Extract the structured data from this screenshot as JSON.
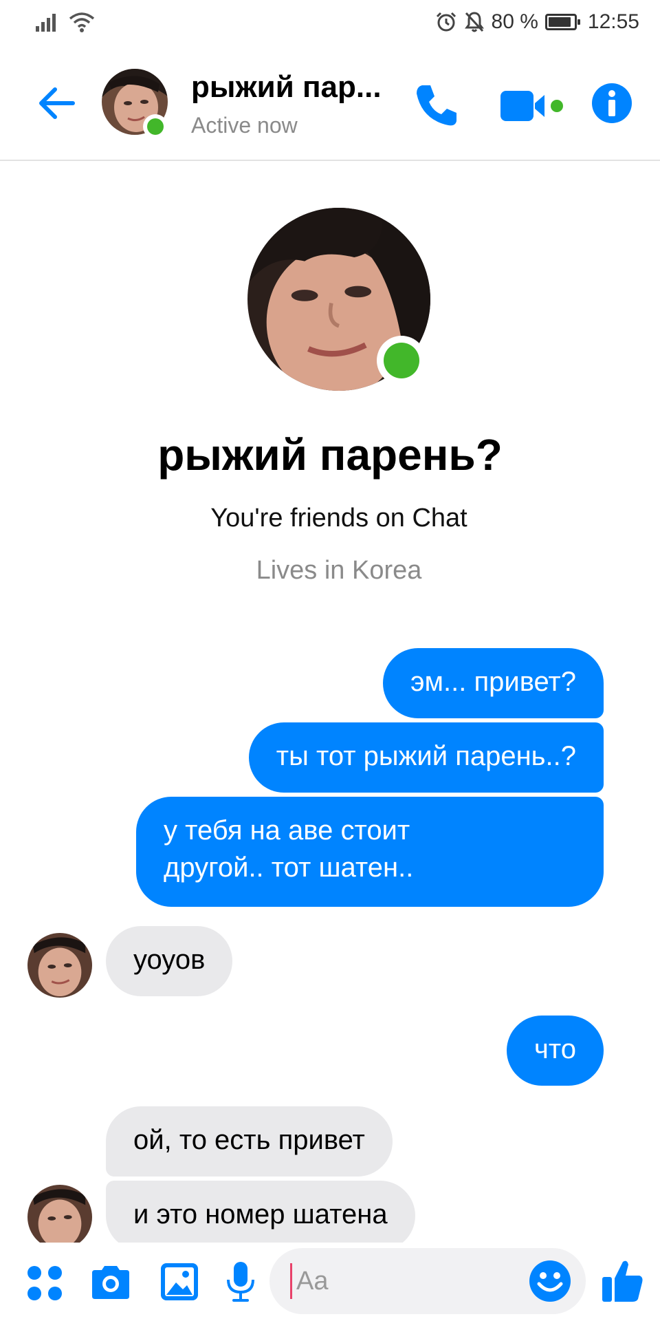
{
  "status_bar": {
    "battery": "80 %",
    "battery_level_percent": 80,
    "time": "12:55",
    "icons": [
      "signal-icon",
      "wifi-icon",
      "alarm-icon",
      "mute-icon",
      "battery-icon"
    ]
  },
  "header": {
    "contact_name": "рыжий пар...",
    "status": "Active now",
    "accent": "#0084ff",
    "online_color": "#42b72a"
  },
  "profile": {
    "name": "рыжий парень?",
    "friends_line": "You're friends on Chat",
    "lives_line": "Lives in Korea"
  },
  "messages": [
    {
      "direction": "outgoing",
      "lines": [
        "эм... привет?"
      ]
    },
    {
      "direction": "outgoing",
      "lines": [
        "ты тот рыжий парень..?"
      ]
    },
    {
      "direction": "outgoing",
      "lines": [
        "у тебя на аве стоит",
        "другой.. тот шатен.."
      ]
    },
    {
      "direction": "incoming",
      "lines": [
        "уоуов"
      ]
    },
    {
      "direction": "outgoing",
      "lines": [
        "что"
      ]
    },
    {
      "direction": "incoming",
      "lines": [
        "ой, то есть привет"
      ]
    },
    {
      "direction": "incoming",
      "lines": [
        "и это номер шатена"
      ]
    }
  ],
  "composer": {
    "placeholder": "Aa",
    "icons": [
      "apps-icon",
      "camera-icon",
      "gallery-icon",
      "microphone-icon",
      "emoji-icon",
      "like-icon"
    ]
  }
}
